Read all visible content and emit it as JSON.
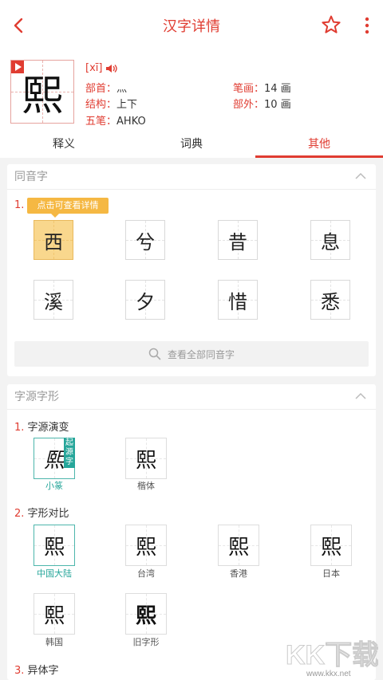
{
  "topbar": {
    "title": "汉字详情"
  },
  "character": {
    "glyph": "熙",
    "pinyin": "[xī]",
    "fields": [
      {
        "k": "部首",
        "v": "灬"
      },
      {
        "k": "笔画",
        "v": "14 画"
      },
      {
        "k": "结构",
        "v": "上下"
      },
      {
        "k": "部外",
        "v": "10 画"
      },
      {
        "k": "五笔",
        "v": "AHKO"
      }
    ]
  },
  "tabs": [
    "释义",
    "词典",
    "其他"
  ],
  "homophones": {
    "title": "同音字",
    "index": "1.",
    "tooltip": "点击可查看详情",
    "chars": [
      "西",
      "兮",
      "昔",
      "息",
      "溪",
      "夕",
      "惜",
      "悉"
    ],
    "view_all": "查看全部同音字"
  },
  "origin": {
    "title": "字源字形",
    "sections": [
      {
        "n": "1.",
        "label": "字源演变"
      },
      {
        "n": "2.",
        "label": "字形对比"
      },
      {
        "n": "3.",
        "label": "异体字"
      }
    ],
    "evolution": [
      {
        "glyph": "熙",
        "caption": "小篆",
        "badge": "起源字"
      },
      {
        "glyph": "熙",
        "caption": "楷体"
      }
    ],
    "compare": [
      {
        "glyph": "熙",
        "caption": "中国大陆"
      },
      {
        "glyph": "熙",
        "caption": "台湾"
      },
      {
        "glyph": "熙",
        "caption": "香港"
      },
      {
        "glyph": "熙",
        "caption": "日本"
      },
      {
        "glyph": "熙",
        "caption": "韩国"
      },
      {
        "glyph": "熙",
        "caption": "旧字形"
      }
    ]
  },
  "watermark": {
    "brand": "KK下载",
    "url": "www.kkx.net"
  },
  "colors": {
    "accent": "#e03c31",
    "highlight": "#f9d78d",
    "teal": "#26a69a"
  }
}
